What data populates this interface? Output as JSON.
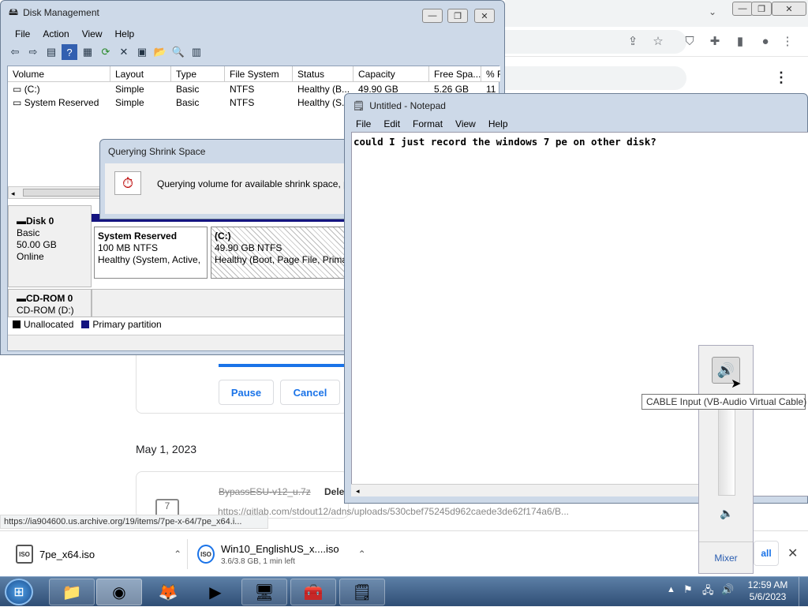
{
  "chrome": {
    "download_buttons": {
      "pause": "Pause",
      "cancel": "Cancel"
    },
    "date_header": "May 1, 2023",
    "old_download": {
      "name": "BypassESU-v12_u.7z",
      "action": "Dele",
      "url": "https://gitlab.com/stdout12/adns/uploads/530cbef75245d962caede3de62f174a6/B..."
    },
    "status_url": "https://ia904600.us.archive.org/19/items/7pe-x-64/7pe_x64.i...",
    "shelf": {
      "items": [
        {
          "name": "7pe_x64.iso",
          "icon": "ISO"
        },
        {
          "name": "Win10_EnglishUS_x....iso",
          "progress_text": "3.6/3.8 GB, 1 min left",
          "icon": "ISO"
        }
      ],
      "show_all": "all"
    }
  },
  "disk_management": {
    "title": "Disk Management",
    "menu": [
      "File",
      "Action",
      "View",
      "Help"
    ],
    "columns": [
      "Volume",
      "Layout",
      "Type",
      "File System",
      "Status",
      "Capacity",
      "Free Spa...",
      "% F"
    ],
    "rows": [
      [
        "(C:)",
        "Simple",
        "Basic",
        "NTFS",
        "Healthy (B...",
        "49.90 GB",
        "5.26 GB",
        "11"
      ],
      [
        "System Reserved",
        "Simple",
        "Basic",
        "NTFS",
        "Healthy (S...",
        "",
        "",
        ""
      ]
    ],
    "disk0": {
      "name": "Disk 0",
      "type": "Basic",
      "size": "50.00 GB",
      "state": "Online"
    },
    "partitions": [
      {
        "name": "System Reserved",
        "size": "100 MB NTFS",
        "status": "Healthy (System, Active,"
      },
      {
        "name": "(C:)",
        "size": "49.90 GB NTFS",
        "status": "Healthy (Boot, Page File, Primar"
      }
    ],
    "cdrom": {
      "name": "CD-ROM 0",
      "drive": "CD-ROM (D:)"
    },
    "legend": {
      "unallocated": "Unallocated",
      "primary": "Primary partition"
    }
  },
  "shrink_dialog": {
    "title": "Querying Shrink Space",
    "message": "Querying volume for available shrink space, please"
  },
  "notepad": {
    "title": "Untitled - Notepad",
    "menu": [
      "File",
      "Edit",
      "Format",
      "View",
      "Help"
    ],
    "content": "could I just record the windows 7 pe on other disk?"
  },
  "volume_mixer": {
    "tooltip": "CABLE Input (VB-Audio Virtual Cable)",
    "mixer_label": "Mixer"
  },
  "taskbar": {
    "time": "12:59 AM",
    "date": "5/6/2023"
  }
}
